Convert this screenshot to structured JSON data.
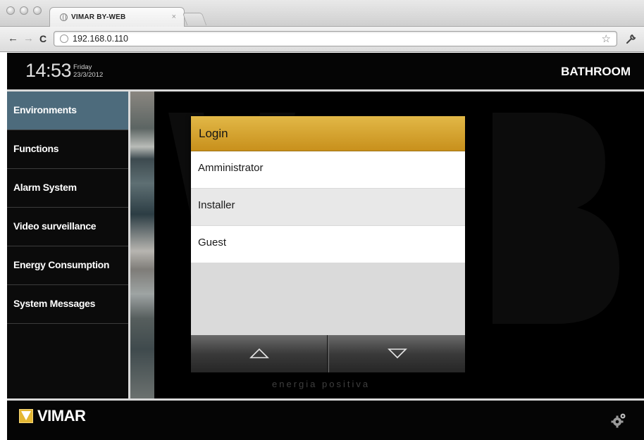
{
  "browser": {
    "tab_title": "VIMAR BY-WEB",
    "tab_close": "×",
    "url": "192.168.0.110",
    "star": "☆",
    "wrench": "🔧",
    "back": "←",
    "forward": "→",
    "reload": "C"
  },
  "header": {
    "time": "14:53",
    "day": "Friday",
    "date": "23/3/2012",
    "room": "BATHROOM"
  },
  "sidebar": {
    "items": [
      {
        "label": "Environments",
        "active": true
      },
      {
        "label": "Functions",
        "active": false
      },
      {
        "label": "Alarm System",
        "active": false
      },
      {
        "label": "Video surveillance",
        "active": false
      },
      {
        "label": "Energy Consumption",
        "active": false
      },
      {
        "label": "System Messages",
        "active": false
      }
    ]
  },
  "background": {
    "tagline": "energia positiva"
  },
  "footer": {
    "logo_text": "VIMAR"
  },
  "login_dialog": {
    "title": "Login",
    "options": [
      "Amministrator",
      "Installer",
      "Guest"
    ],
    "pager_up_icon": "up-triangle-icon",
    "pager_down_icon": "down-triangle-icon"
  },
  "colors": {
    "accent_gold": "#d4a22e",
    "sidebar_active": "#4d6b7c",
    "logo_yellow": "#e4b734"
  }
}
